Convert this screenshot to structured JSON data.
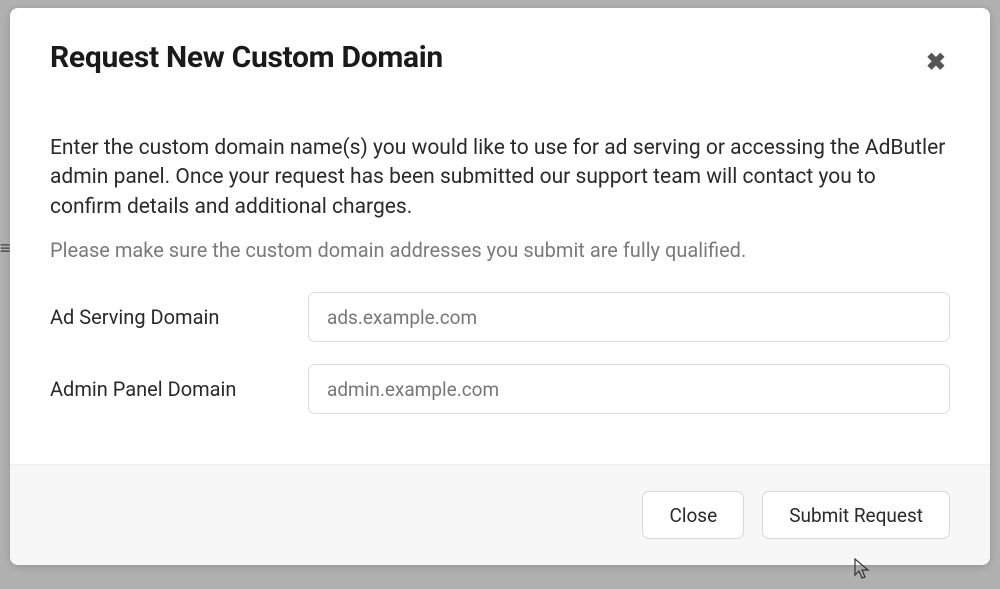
{
  "modal": {
    "title": "Request New Custom Domain",
    "description": "Enter the custom domain name(s) you would like to use for ad serving or accessing the AdButler admin panel. Once your request has been submitted our support team will contact you to confirm details and additional charges.",
    "note": "Please make sure the custom domain addresses you submit are fully qualified.",
    "fields": {
      "adServing": {
        "label": "Ad Serving Domain",
        "placeholder": "ads.example.com",
        "value": ""
      },
      "adminPanel": {
        "label": "Admin Panel Domain",
        "placeholder": "admin.example.com",
        "value": ""
      }
    },
    "buttons": {
      "close": "Close",
      "submit": "Submit Request"
    }
  }
}
